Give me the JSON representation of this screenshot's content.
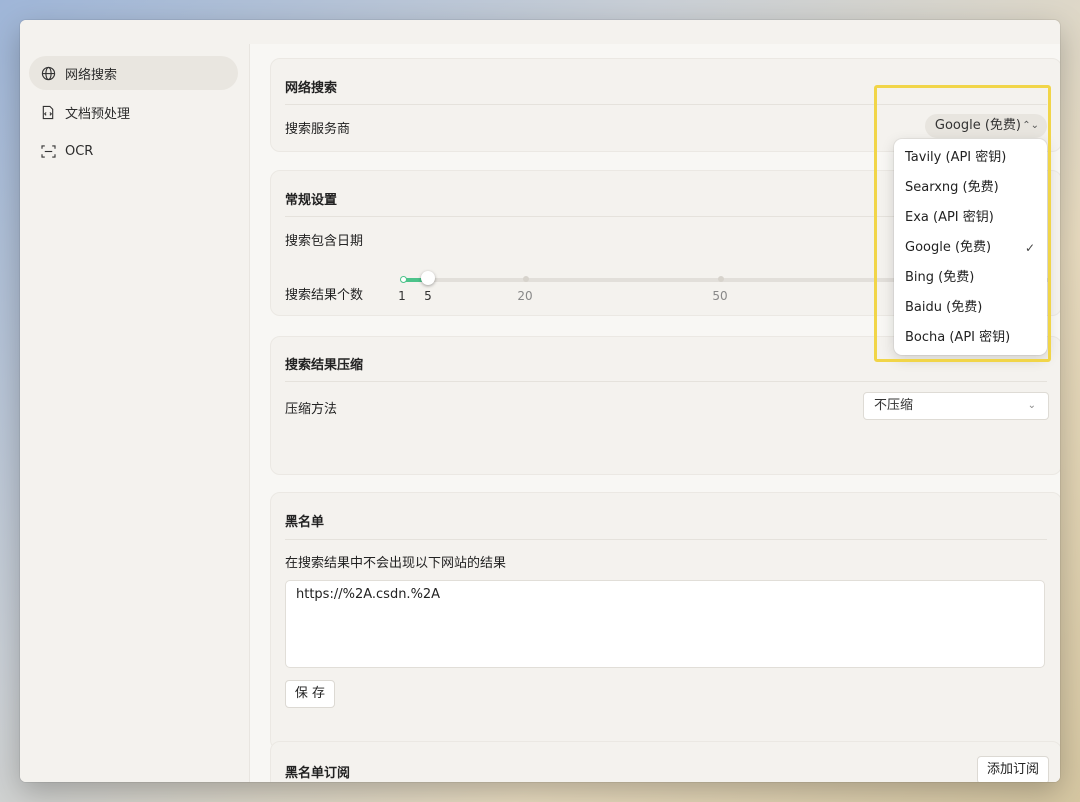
{
  "sidebar": {
    "items": [
      {
        "label": "网络搜索",
        "icon": "globe-icon"
      },
      {
        "label": "文档预处理",
        "icon": "document-icon"
      },
      {
        "label": "OCR",
        "icon": "ocr-icon"
      }
    ]
  },
  "web_search": {
    "title": "网络搜索",
    "provider_label": "搜索服务商",
    "provider_value": "Google (免费)"
  },
  "general": {
    "title": "常规设置",
    "include_date_label": "搜索包含日期",
    "result_count_label": "搜索结果个数",
    "result_count_value": 5,
    "ticks": [
      "1",
      "5",
      "20",
      "50"
    ]
  },
  "compression": {
    "title": "搜索结果压缩",
    "method_label": "压缩方法",
    "method_value": "不压缩"
  },
  "blacklist": {
    "title": "黑名单",
    "description": "在搜索结果中不会出现以下网站的结果",
    "textarea_value": "https://%2A.csdn.%2A",
    "save_label": "保 存"
  },
  "subscription": {
    "title": "黑名单订阅",
    "add_label": "添加订阅"
  },
  "provider_dropdown": {
    "options": [
      {
        "label": "Tavily (API 密钥)",
        "selected": false
      },
      {
        "label": "Searxng (免费)",
        "selected": false
      },
      {
        "label": "Exa (API 密钥)",
        "selected": false
      },
      {
        "label": "Google (免费)",
        "selected": true
      },
      {
        "label": "Bing (免费)",
        "selected": false
      },
      {
        "label": "Baidu (免费)",
        "selected": false
      },
      {
        "label": "Bocha (API 密钥)",
        "selected": false
      }
    ],
    "check_mark": "✓"
  },
  "colors": {
    "accent": "#4cc38a",
    "highlight": "#f1d548"
  }
}
